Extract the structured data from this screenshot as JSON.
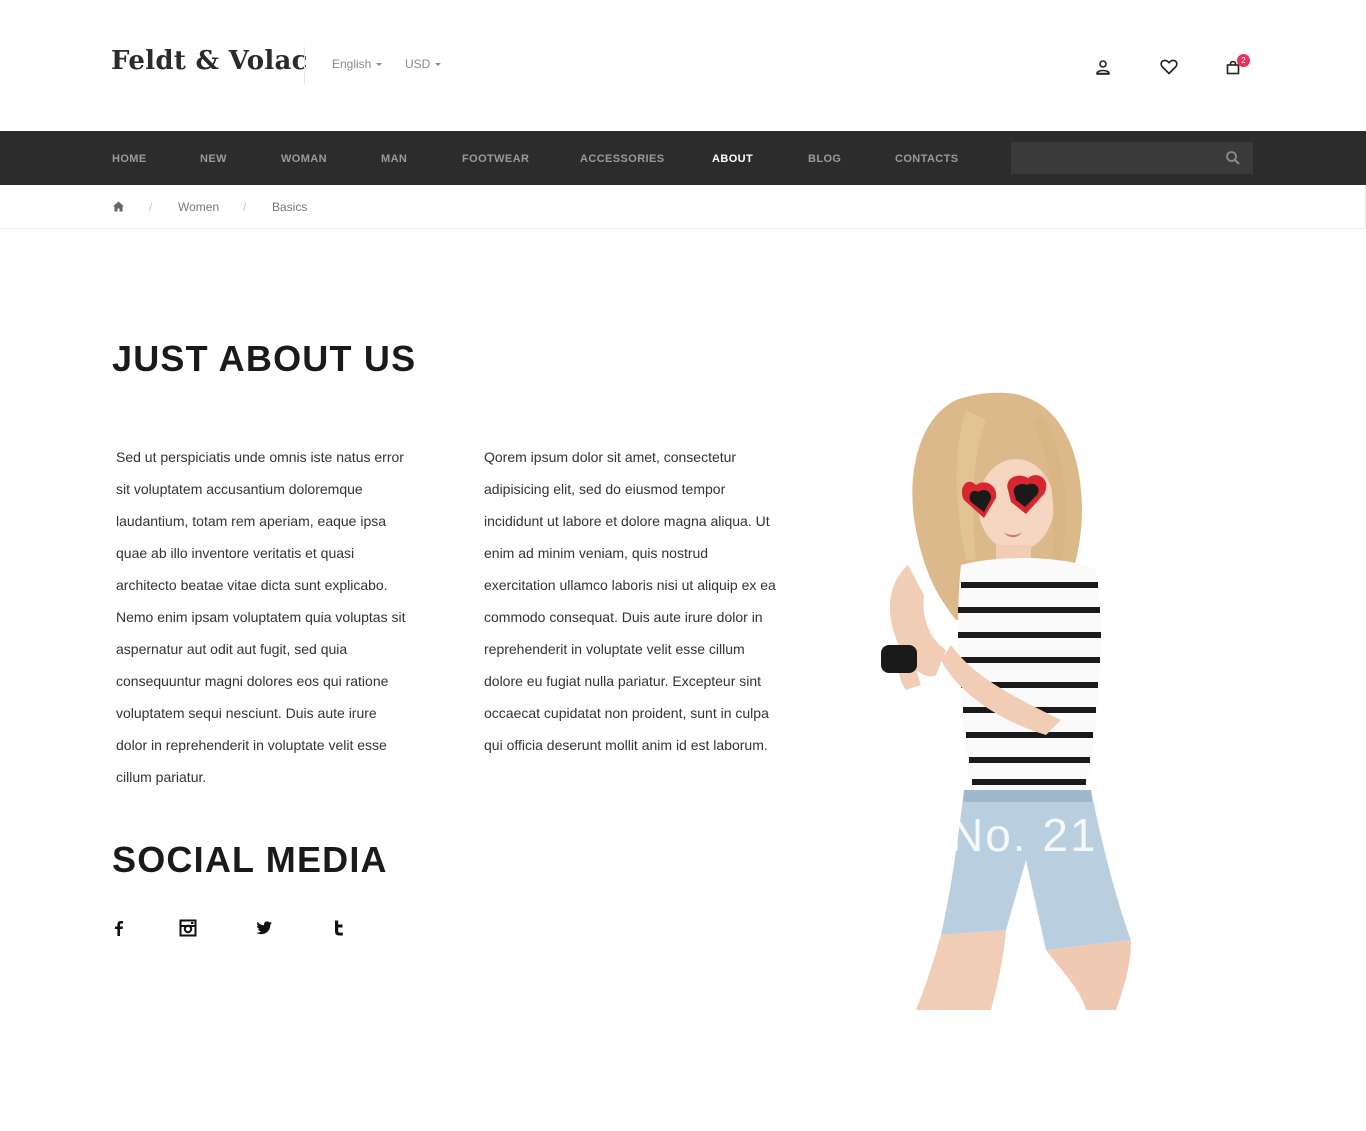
{
  "header": {
    "brand": "Feldt & Volac",
    "language": "English",
    "currency": "USD",
    "cart_count": "2",
    "icons": [
      "user-icon",
      "heart-icon",
      "cart-icon"
    ]
  },
  "nav": {
    "items": [
      {
        "label": "HOME"
      },
      {
        "label": "NEW"
      },
      {
        "label": "WOMAN"
      },
      {
        "label": "MAN"
      },
      {
        "label": "FOOTWEAR"
      },
      {
        "label": "ACCESSORIES"
      },
      {
        "label": "ABOUT",
        "active": true
      },
      {
        "label": "BLOG"
      },
      {
        "label": "CONTACTS"
      }
    ],
    "search_placeholder": ""
  },
  "breadcrumb": {
    "sep": "/",
    "items": [
      "Women",
      "Basics"
    ]
  },
  "main": {
    "about_title": "JUST ABOUT US",
    "paragraph_1": "Sed ut perspiciatis unde omnis iste natus error sit voluptatem accusantium doloremque laudantium, totam rem aperiam, eaque ipsa quae ab illo inventore veritatis et quasi architecto beatae vitae dicta sunt explicabo. Nemo enim ipsam voluptatem quia voluptas sit aspernatur aut odit aut fugit, sed quia consequuntur magni dolores eos qui ratione voluptatem sequi nesciunt. Duis aute irure dolor in reprehenderit in voluptate velit esse cillum pariatur.",
    "paragraph_2": "Qorem ipsum dolor sit amet, consectetur adipisicing elit, sed do eiusmod tempor incididunt ut labore et dolore magna aliqua. Ut enim ad minim veniam, quis nostrud exercitation ullamco laboris nisi ut aliquip ex ea commodo consequat. Duis aute irure dolor in reprehenderit in voluptate velit esse cillum dolore eu fugiat nulla pariatur. Excepteur sint occaecat cupidatat non proident, sunt in culpa qui officia deserunt mollit anim id est laborum.",
    "social_title": "SOCIAL MEDIA",
    "social_icons": [
      "facebook-icon",
      "instagram-icon",
      "twitter-icon",
      "tumblr-icon"
    ],
    "image_caption": "No. 21"
  },
  "colors": {
    "nav_bg": "#2c2c2c",
    "badge": "#e8335a",
    "accent_red": "#d8262e"
  }
}
